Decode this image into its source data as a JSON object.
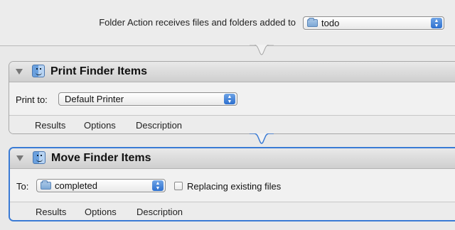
{
  "folder_action": {
    "label": "Folder Action receives files and folders added to",
    "folder_value": "todo"
  },
  "actions": [
    {
      "title": "Print Finder Items",
      "field_label": "Print to:",
      "popup_value": "Default Printer",
      "tabs": [
        "Results",
        "Options",
        "Description"
      ]
    },
    {
      "title": "Move Finder Items",
      "field_label": "To:",
      "popup_value": "completed",
      "checkbox_label": "Replacing existing files",
      "tabs": [
        "Results",
        "Options",
        "Description"
      ]
    }
  ],
  "icons": {
    "folder": "folder-icon",
    "finder": "finder-icon",
    "disclosure": "disclosure-triangle-icon",
    "stepper": "popup-stepper-icon"
  },
  "colors": {
    "selection_border": "#3a7bd5",
    "stepper": "#2c6fcf"
  }
}
